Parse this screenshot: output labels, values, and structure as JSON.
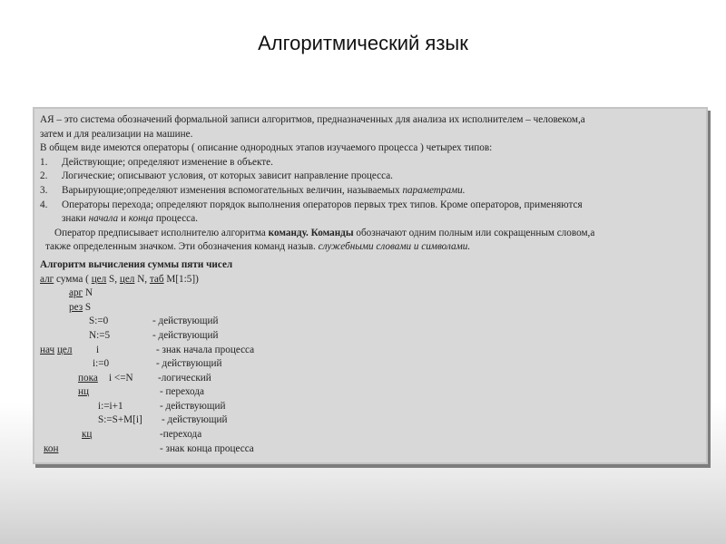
{
  "title": "Алгоритмический язык",
  "intro": {
    "line1": "АЯ – это система обозначений формальной записи алгоритмов, предназначенных для анализа их исполнителем – человеком,а",
    "line2": "затем и для реализации на машине.",
    "line3": "В общем виде имеются операторы ( описание однородных этапов изучаемого процесса ) четырех типов:"
  },
  "operators": [
    {
      "num": "1.",
      "text": "Действующие; определяют изменение в объекте."
    },
    {
      "num": "2.",
      "text": "Логические; описывают условия, от которых зависит направление процесса."
    },
    {
      "num": "3.",
      "text_before": "Варьирующие;определяют изменения вспомогательных величин, называемых ",
      "text_italic": "параметрами."
    },
    {
      "num": "4.",
      "line1": "Операторы перехода; определяют порядок выполнения операторов первых трех типов. Кроме операторов, применяются",
      "line2_a": "знаки ",
      "line2_b": "начала",
      "line2_c": " и ",
      "line2_d": "конца",
      "line2_e": " процесса."
    }
  ],
  "command_para": {
    "a": "Оператор предписывает исполнителю алгоритма ",
    "b": "команду. Команды",
    "c": " обозначают одним полным или сокращенным словом,а",
    "d": "также определенным значком. Эти обозначения команд назыв. ",
    "e": "служебными словами и символами."
  },
  "algorithm": {
    "heading": "Алгоритм вычисления суммы пяти чисел",
    "lines": [
      {
        "kw": "алг",
        "text": " сумма ( ",
        "kw2": "цел",
        "t2": " S, ",
        "kw3": "цел",
        "t3": " N, ",
        "kw4": "таб",
        "t4": " M[1:5])"
      },
      {
        "kw": "арг",
        "text": " N"
      },
      {
        "kw": "рез",
        "text": " S"
      },
      {
        "code": "S:=0",
        "comment": "- действующий"
      },
      {
        "code": "N:=5",
        "comment": "- действующий"
      },
      {
        "kw": "нач",
        "kw2": "цел",
        "code": "i",
        "comment": "- знак начала процесса"
      },
      {
        "code": "i:=0",
        "comment": "- действующий"
      },
      {
        "kw": "пока",
        "code": "i <=N",
        "comment": "-логический"
      },
      {
        "kw": "нц",
        "comment": "- перехода"
      },
      {
        "code": "i:=i+1",
        "comment": "- действующий"
      },
      {
        "code": "S:=S+M[i]",
        "comment": "- действующий"
      },
      {
        "kw": "кц",
        "comment": "-перехода"
      },
      {
        "kw": "кон",
        "comment": "- знак конца процесса"
      }
    ]
  }
}
